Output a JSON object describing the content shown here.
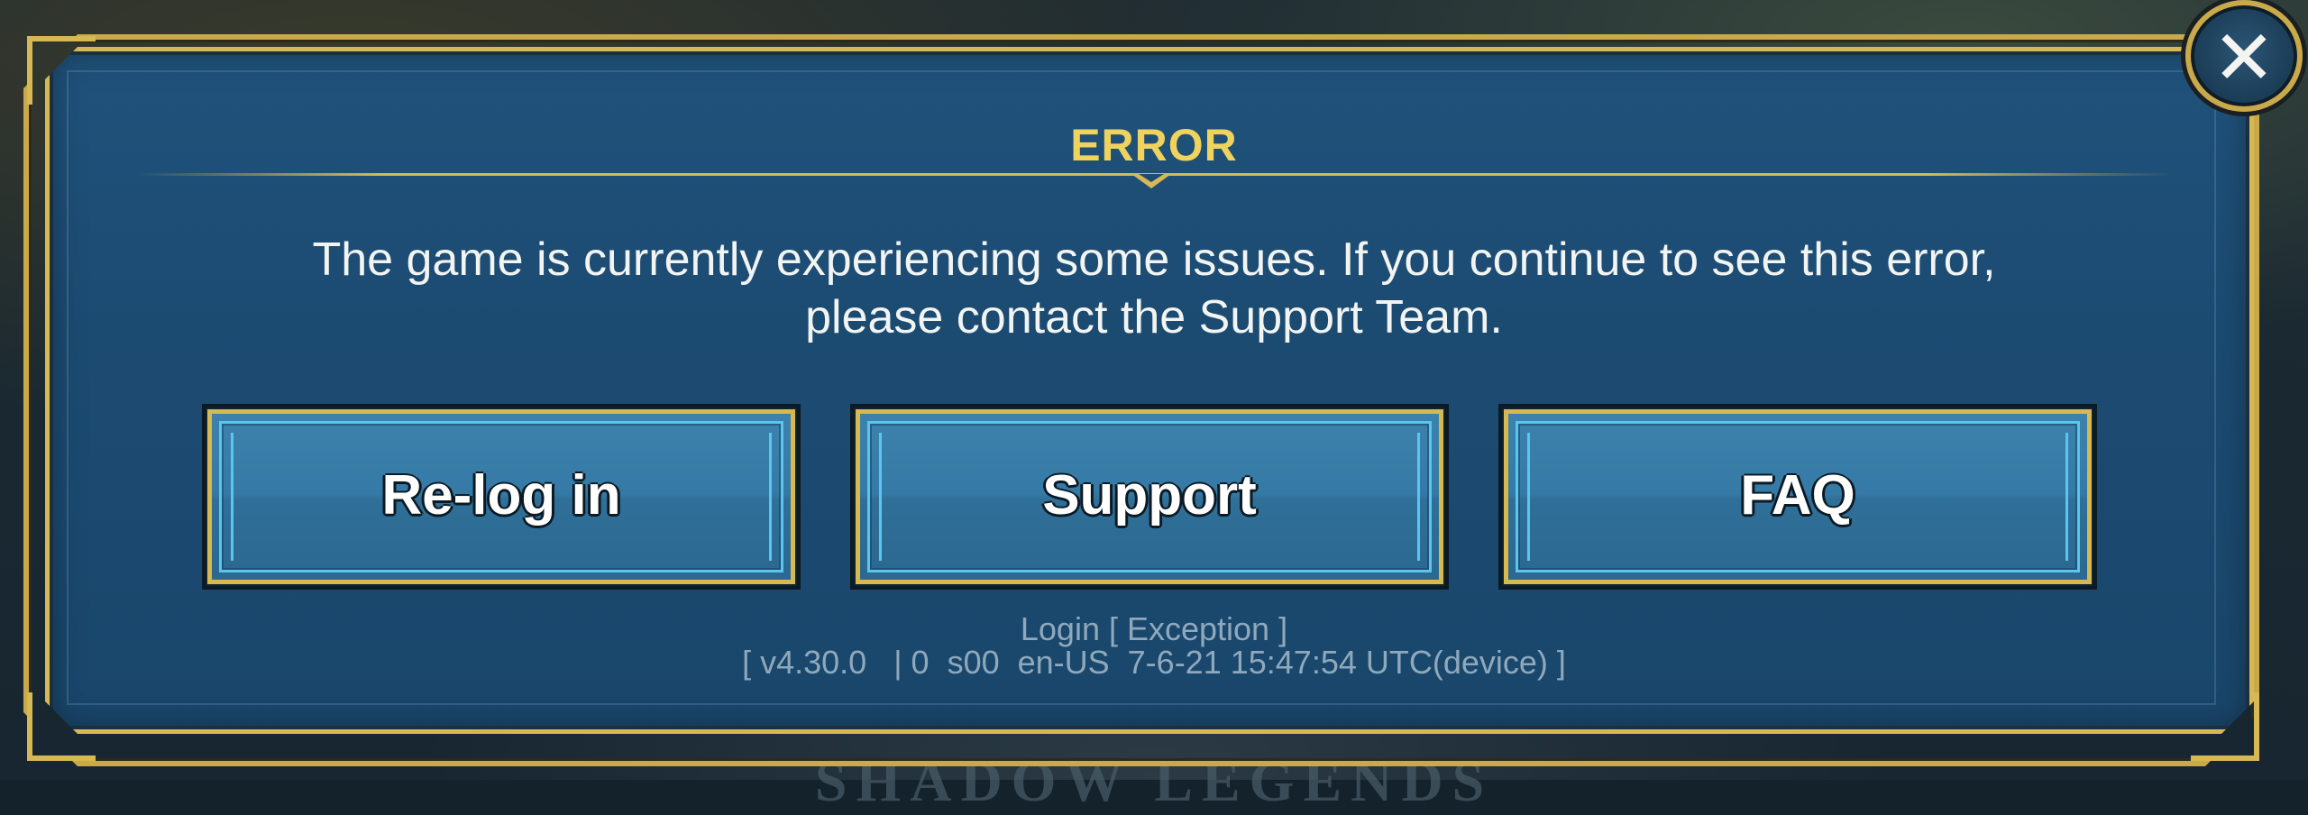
{
  "dialog": {
    "title": "ERROR",
    "message_line1": "The game is currently experiencing some issues. If you continue to see this error,",
    "message_line2": "please contact the Support Team.",
    "buttons": {
      "relog_label": "Re-log in",
      "support_label": "Support",
      "faq_label": "FAQ"
    },
    "error_context": "Login [ Exception ]",
    "build_info": "[ v4.30.0   | 0  s00  en-US  7-6-21 15:47:54 UTC(device) ]",
    "close_icon": "close-icon"
  },
  "background": {
    "partial_title": "SHADOW LEGENDS"
  },
  "colors": {
    "title_gold": "#efd35c",
    "frame_gold": "#d6b954",
    "panel_blue": "#1c4b72",
    "button_blue": "#357aa6",
    "button_cyan_trim": "#58c6ee",
    "meta_text": "#8fa9bc"
  }
}
